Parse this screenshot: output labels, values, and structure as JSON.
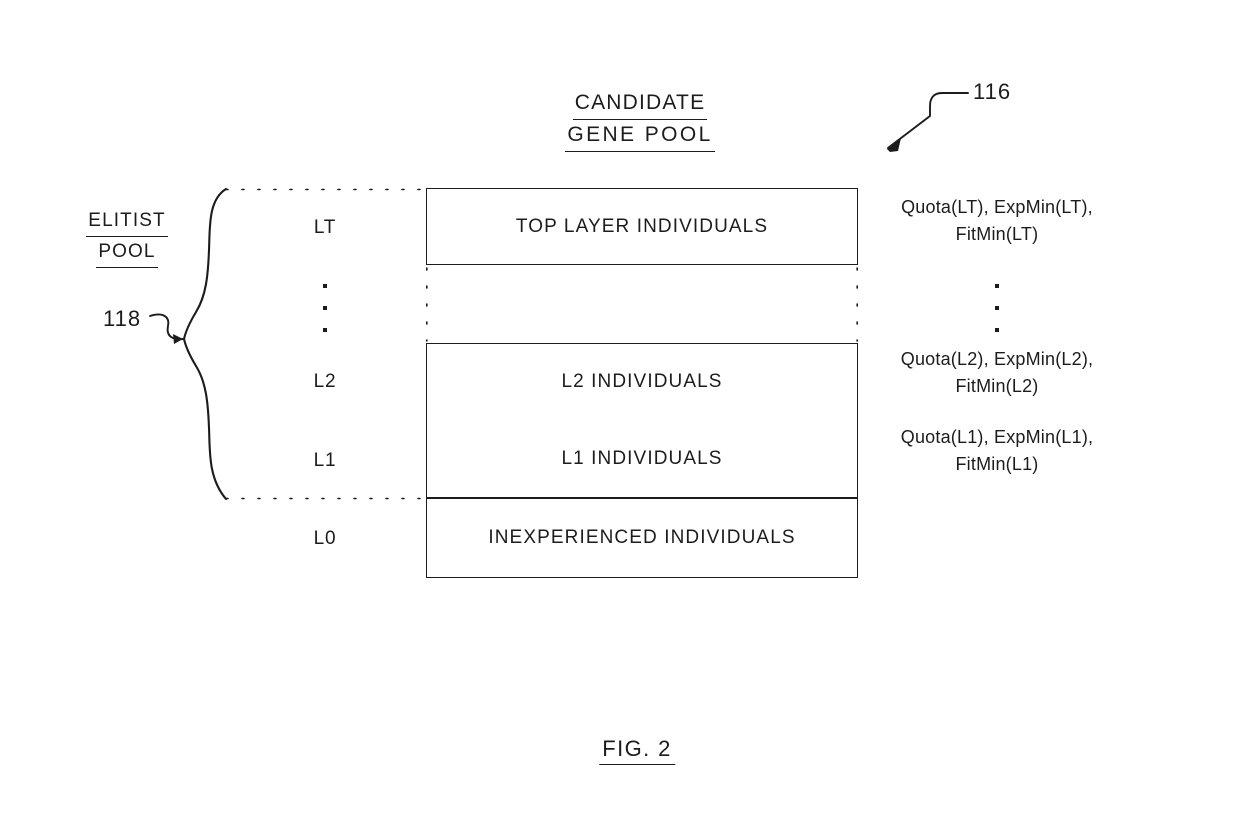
{
  "figure": {
    "caption": "FIG. 2",
    "title_line1": "CANDIDATE",
    "title_line2": "GENE  POOL",
    "title_ref": "116",
    "elitist_line1": "ELITIST",
    "elitist_line2": "POOL",
    "elitist_ref": "118"
  },
  "layers": [
    {
      "id": "LT",
      "caption": "LT",
      "box_label": "TOP LAYER INDIVIDUALS",
      "annotation_line1": "Quota(LT), ExpMin(LT),",
      "annotation_line2": "FitMin(LT)"
    },
    {
      "id": "L2",
      "caption": "L2",
      "box_label": "L2 INDIVIDUALS",
      "annotation_line1": "Quota(L2), ExpMin(L2),",
      "annotation_line2": "FitMin(L2)"
    },
    {
      "id": "L1",
      "caption": "L1",
      "box_label": "L1 INDIVIDUALS",
      "annotation_line1": "Quota(L1), ExpMin(L1),",
      "annotation_line2": "FitMin(L1)"
    },
    {
      "id": "L0",
      "caption": "L0",
      "box_label": "INEXPERIENCED INDIVIDUALS",
      "annotation_line1": "",
      "annotation_line2": ""
    }
  ],
  "ellipsis": {
    "layers_column": "vertical-ellipsis",
    "annotation_column": "vertical-ellipsis",
    "box_gap": "vertical-ellipsis"
  },
  "style": {
    "ink": "#1c1c1c",
    "background": "#ffffff"
  }
}
